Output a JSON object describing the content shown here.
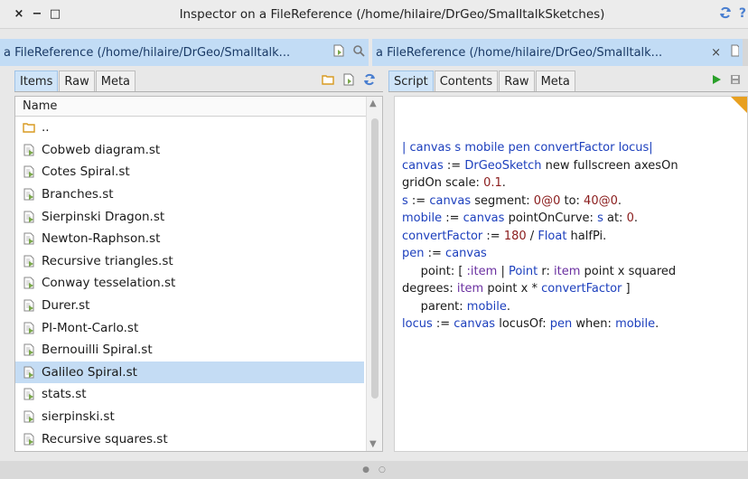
{
  "window": {
    "title": "Inspector on a FileReference (/home/hilaire/DrGeo/SmalltalkSketches)",
    "close_glyph": "×",
    "minimize_glyph": "−",
    "maximize_glyph": "□"
  },
  "breadcrumbs": {
    "left": "a FileReference (/home/hilaire/DrGeo/Smalltalk...",
    "right": "a FileReference (/home/hilaire/DrGeo/Smalltalk...",
    "right_close": "×"
  },
  "left_pane": {
    "tabs": [
      "Items",
      "Raw",
      "Meta"
    ],
    "active_tab": "Items",
    "column_header": "Name",
    "items": [
      {
        "name": "..",
        "icon": "folder-icon"
      },
      {
        "name": "Cobweb diagram.st",
        "icon": "file-icon"
      },
      {
        "name": "Cotes Spiral.st",
        "icon": "file-icon"
      },
      {
        "name": "Branches.st",
        "icon": "file-icon"
      },
      {
        "name": "Sierpinski Dragon.st",
        "icon": "file-icon"
      },
      {
        "name": "Newton-Raphson.st",
        "icon": "file-icon"
      },
      {
        "name": "Recursive triangles.st",
        "icon": "file-icon"
      },
      {
        "name": "Conway tesselation.st",
        "icon": "file-icon"
      },
      {
        "name": "Durer.st",
        "icon": "file-icon"
      },
      {
        "name": "PI-Mont-Carlo.st",
        "icon": "file-icon"
      },
      {
        "name": "Bernouilli Spiral.st",
        "icon": "file-icon"
      },
      {
        "name": "Galileo Spiral.st",
        "icon": "file-icon",
        "selected": true
      },
      {
        "name": "stats.st",
        "icon": "file-icon"
      },
      {
        "name": "sierpinski.st",
        "icon": "file-icon"
      },
      {
        "name": "Recursive squares.st",
        "icon": "file-icon"
      }
    ]
  },
  "right_pane": {
    "tabs": [
      "Script",
      "Contents",
      "Raw",
      "Meta"
    ],
    "active_tab": "Script",
    "code_lines": [
      [
        {
          "t": "| canvas s mobile pen convertFactor locus|",
          "c": "kw-blue"
        }
      ],
      [
        {
          "t": "canvas",
          "c": "kw-blue"
        },
        {
          "t": " := ",
          "c": ""
        },
        {
          "t": "DrGeoSketch",
          "c": "kw-blue"
        },
        {
          "t": " new fullscreen axesOn",
          "c": ""
        }
      ],
      [
        {
          "t": "gridOn scale: ",
          "c": ""
        },
        {
          "t": "0.1",
          "c": "kw-red"
        },
        {
          "t": ".",
          "c": ""
        }
      ],
      [
        {
          "t": "s",
          "c": "kw-blue"
        },
        {
          "t": " := ",
          "c": ""
        },
        {
          "t": "canvas",
          "c": "kw-blue"
        },
        {
          "t": " segment: ",
          "c": ""
        },
        {
          "t": "0@0",
          "c": "kw-red"
        },
        {
          "t": " to: ",
          "c": ""
        },
        {
          "t": "40@0",
          "c": "kw-red"
        },
        {
          "t": ".",
          "c": ""
        }
      ],
      [
        {
          "t": "mobile",
          "c": "kw-blue"
        },
        {
          "t": " := ",
          "c": ""
        },
        {
          "t": "canvas",
          "c": "kw-blue"
        },
        {
          "t": " pointOnCurve: ",
          "c": ""
        },
        {
          "t": "s",
          "c": "kw-blue"
        },
        {
          "t": " at: ",
          "c": ""
        },
        {
          "t": "0",
          "c": "kw-red"
        },
        {
          "t": ".",
          "c": ""
        }
      ],
      [
        {
          "t": "convertFactor",
          "c": "kw-blue"
        },
        {
          "t": " := ",
          "c": ""
        },
        {
          "t": "180",
          "c": "kw-red"
        },
        {
          "t": " / ",
          "c": ""
        },
        {
          "t": "Float",
          "c": "kw-blue"
        },
        {
          "t": " halfPi.",
          "c": ""
        }
      ],
      [
        {
          "t": "pen",
          "c": "kw-blue"
        },
        {
          "t": " := ",
          "c": ""
        },
        {
          "t": "canvas",
          "c": "kw-blue"
        }
      ],
      [
        {
          "t": "     point: [ ",
          "c": ""
        },
        {
          "t": ":item",
          "c": "kw-purple"
        },
        {
          "t": " | ",
          "c": ""
        },
        {
          "t": "Point",
          "c": "kw-blue"
        },
        {
          "t": " r: ",
          "c": ""
        },
        {
          "t": "item",
          "c": "kw-purple"
        },
        {
          "t": " point x squared",
          "c": ""
        }
      ],
      [
        {
          "t": "degrees: ",
          "c": ""
        },
        {
          "t": "item",
          "c": "kw-purple"
        },
        {
          "t": " point x * ",
          "c": ""
        },
        {
          "t": "convertFactor",
          "c": "kw-blue"
        },
        {
          "t": " ]",
          "c": ""
        }
      ],
      [
        {
          "t": "     parent: ",
          "c": ""
        },
        {
          "t": "mobile",
          "c": "kw-blue"
        },
        {
          "t": ".",
          "c": ""
        }
      ],
      [
        {
          "t": "locus",
          "c": "kw-blue"
        },
        {
          "t": " := ",
          "c": ""
        },
        {
          "t": "canvas",
          "c": "kw-blue"
        },
        {
          "t": " locusOf: ",
          "c": ""
        },
        {
          "t": "pen",
          "c": "kw-blue"
        },
        {
          "t": " when: ",
          "c": ""
        },
        {
          "t": "mobile",
          "c": "kw-blue"
        },
        {
          "t": ".",
          "c": ""
        }
      ]
    ]
  },
  "colors": {
    "selection": "#c4dcf4",
    "breadcrumb_bg": "#c2dcf5",
    "accent_blue": "#4a7fd0",
    "play_green": "#2aa02a",
    "corner_orange": "#e8a020"
  }
}
